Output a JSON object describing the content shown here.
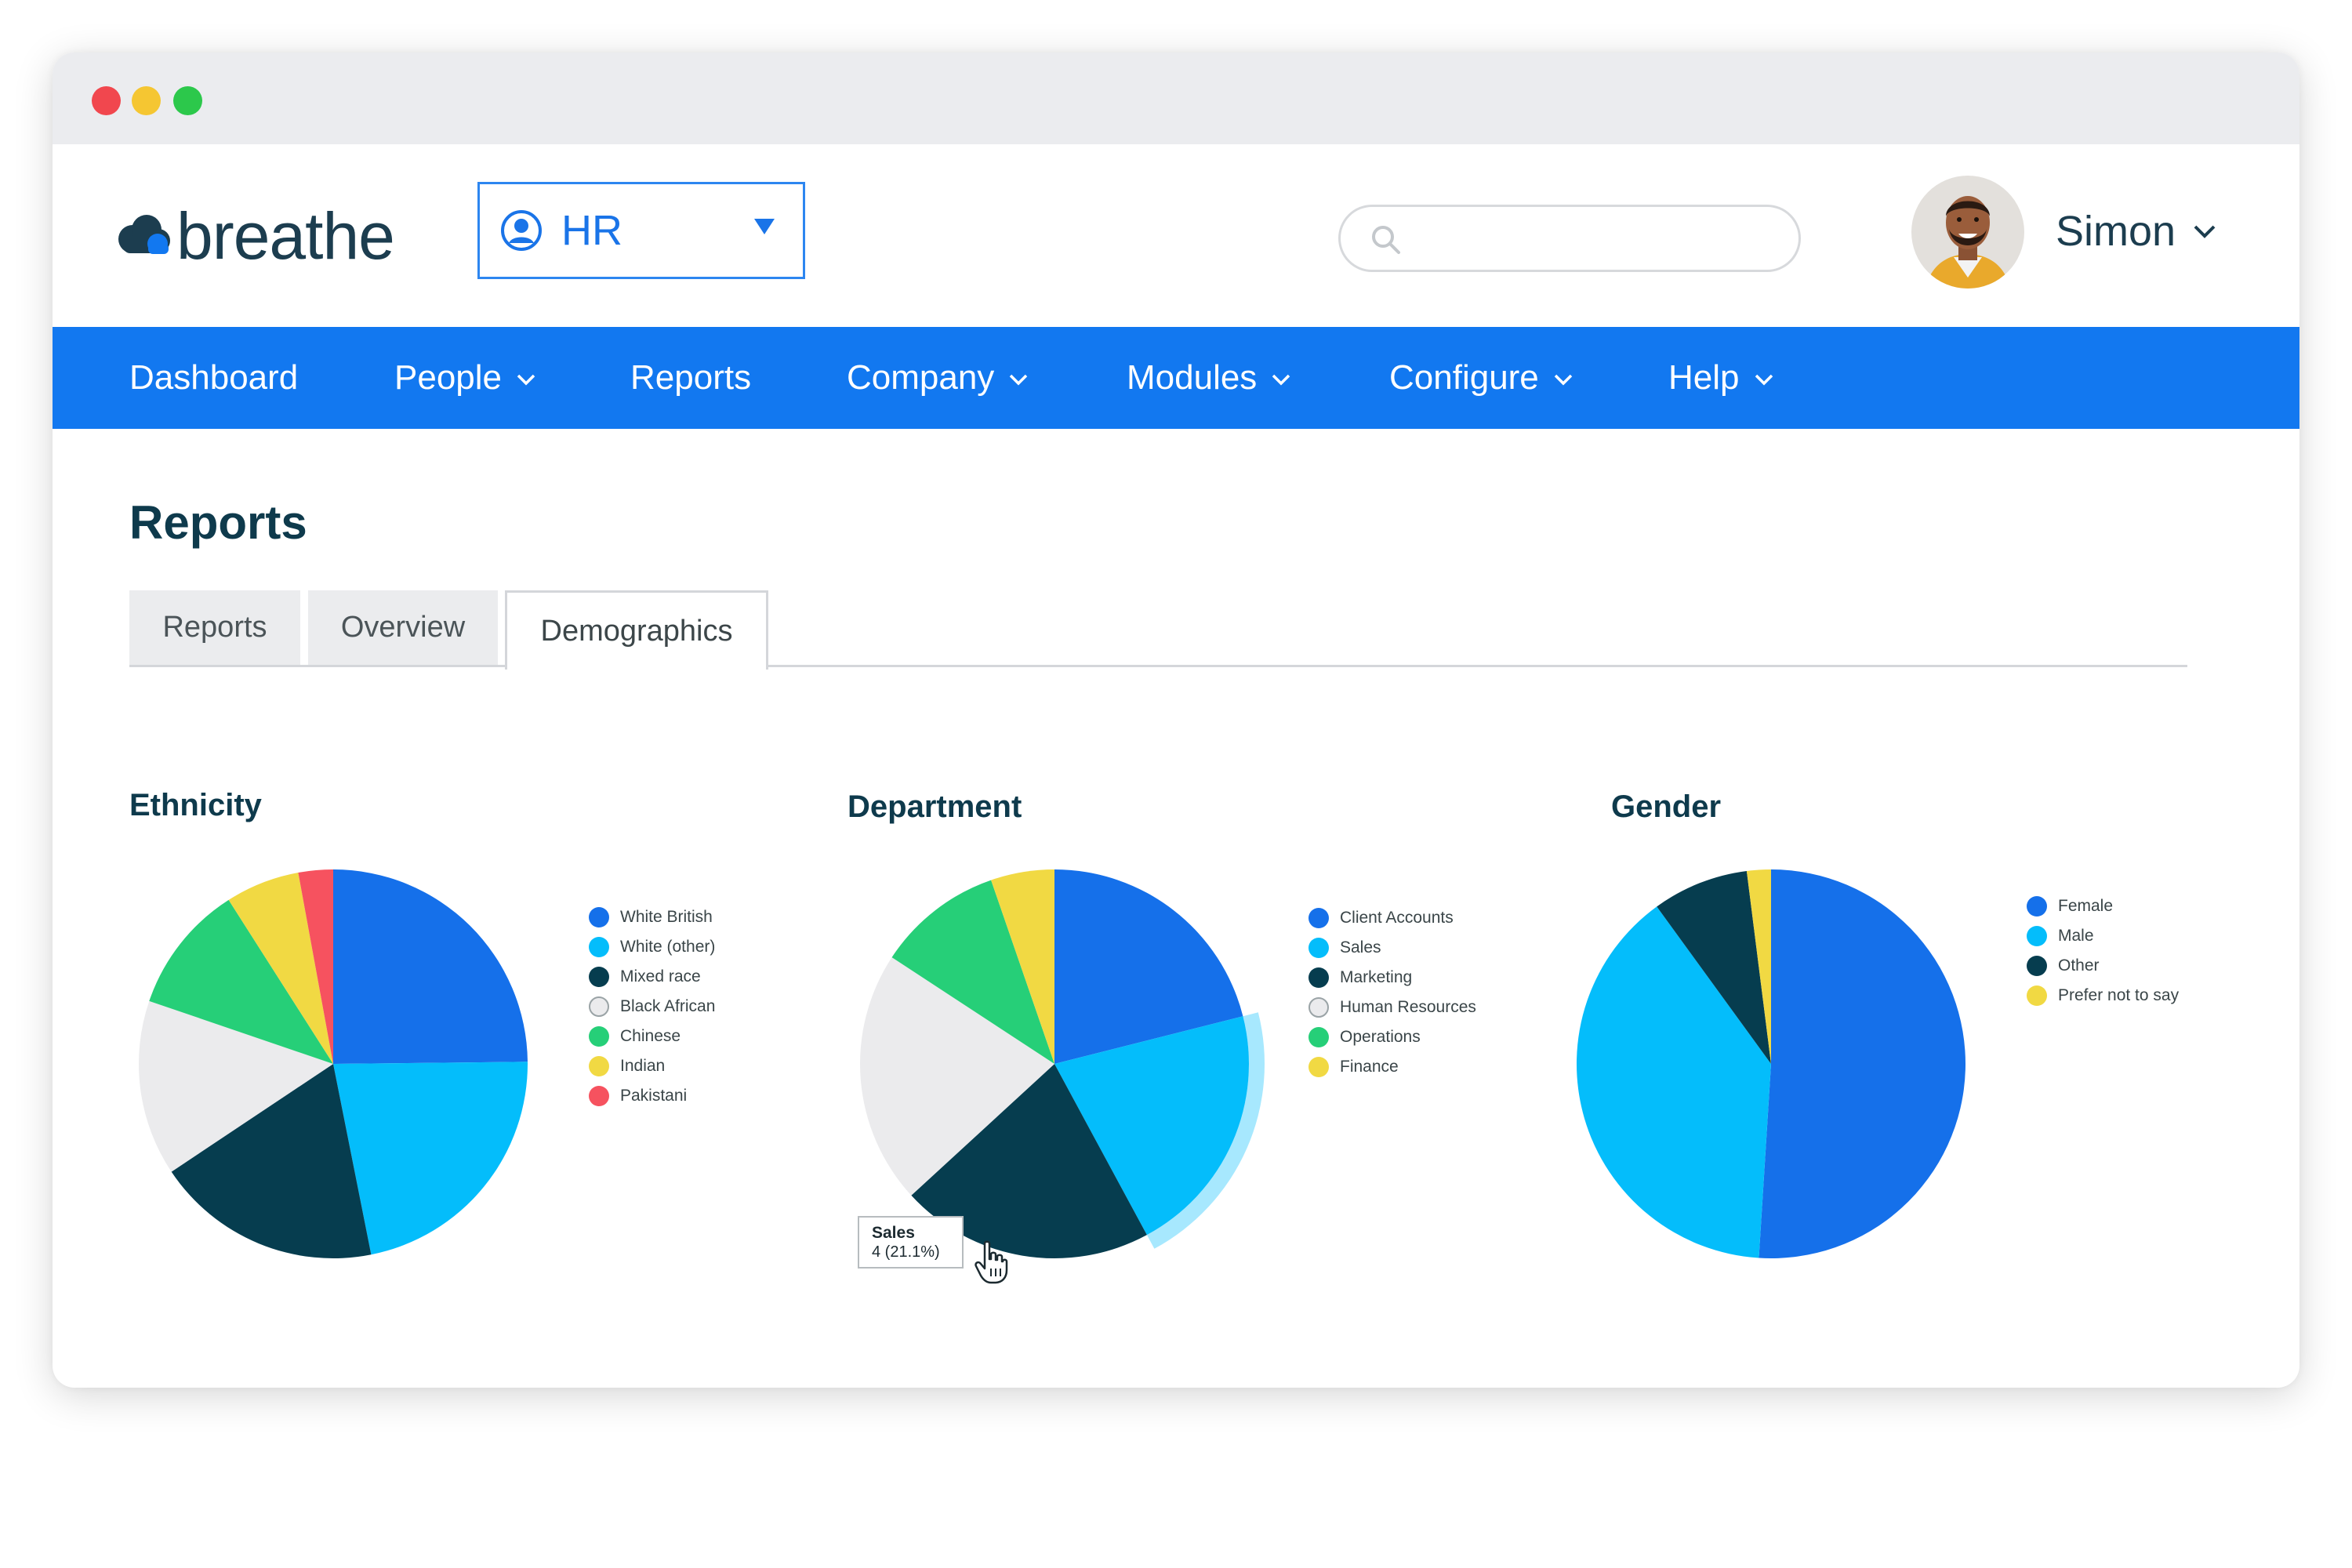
{
  "app": {
    "logo_text": "breathe",
    "module_selector": {
      "value": "HR"
    },
    "search": {
      "placeholder": ""
    },
    "user": {
      "name": "Simon"
    }
  },
  "nav": {
    "items": [
      {
        "label": "Dashboard",
        "has_dropdown": false
      },
      {
        "label": "People",
        "has_dropdown": true
      },
      {
        "label": "Reports",
        "has_dropdown": false
      },
      {
        "label": "Company",
        "has_dropdown": true
      },
      {
        "label": "Modules",
        "has_dropdown": true
      },
      {
        "label": "Configure",
        "has_dropdown": true
      },
      {
        "label": "Help",
        "has_dropdown": true
      }
    ]
  },
  "page": {
    "title": "Reports",
    "tabs": [
      {
        "label": "Reports",
        "active": false
      },
      {
        "label": "Overview",
        "active": false
      },
      {
        "label": "Demographics",
        "active": true
      }
    ]
  },
  "colors": {
    "brand_blue": "#1278f0",
    "dark_text": "#0e3a4c"
  },
  "tooltip": {
    "name": "Sales",
    "value": "4 (21.1%)"
  },
  "chart_data": [
    {
      "type": "pie",
      "title": "Ethnicity",
      "categories": [
        "White British",
        "White (other)",
        "Mixed race",
        "Black African",
        "Chinese",
        "Indian",
        "Pakistani"
      ],
      "values": [
        25,
        22.2,
        18.9,
        14.7,
        10.8,
        6.2,
        2.9
      ],
      "colors": [
        "#1570ea",
        "#04bdfb",
        "#063d4f",
        "#ebebed",
        "#26cf78",
        "#f1d943",
        "#f6525f"
      ],
      "legend_position": "right"
    },
    {
      "type": "pie",
      "title": "Department",
      "categories": [
        "Client Accounts",
        "Sales",
        "Marketing",
        "Human Resources",
        "Operations",
        "Finance"
      ],
      "values": [
        21.1,
        21.1,
        21.1,
        21.1,
        10.5,
        5.3
      ],
      "colors": [
        "#1570ea",
        "#04bdfb",
        "#063d4f",
        "#ebebed",
        "#26cf78",
        "#f1d943"
      ],
      "highlighted": "Sales",
      "legend_position": "right"
    },
    {
      "type": "pie",
      "title": "Gender",
      "categories": [
        "Female",
        "Male",
        "Other",
        "Prefer not to say"
      ],
      "values": [
        51,
        39,
        8,
        2
      ],
      "colors": [
        "#1570ea",
        "#04bdfb",
        "#063d4f",
        "#f1d943"
      ],
      "legend_position": "right"
    }
  ]
}
